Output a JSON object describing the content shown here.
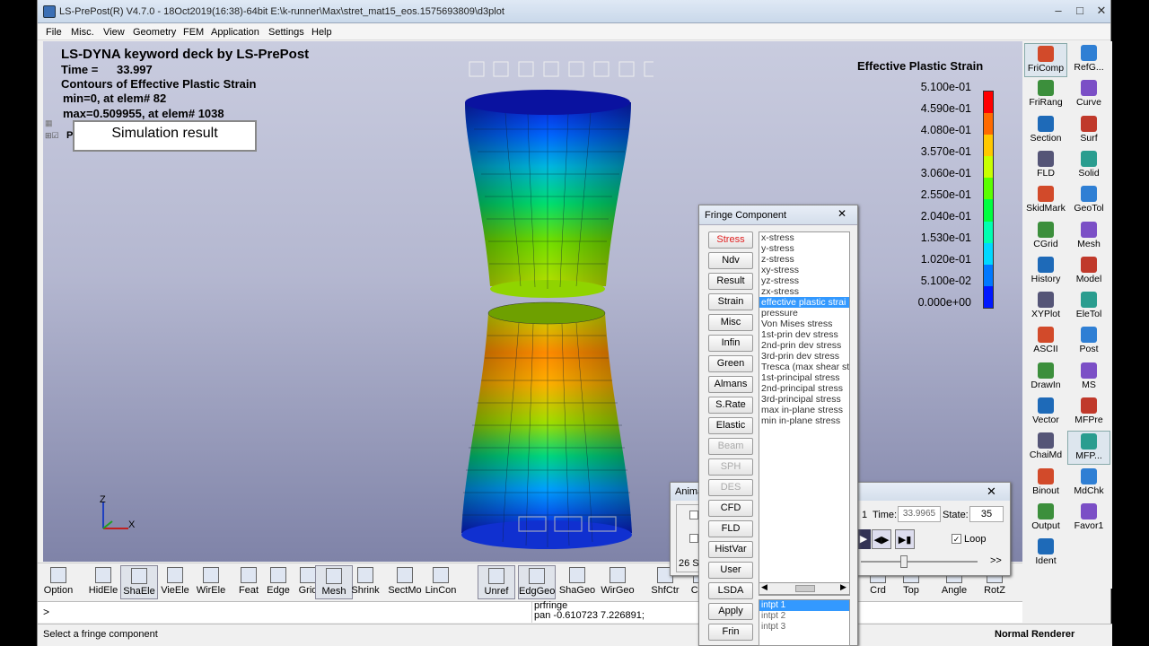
{
  "window": {
    "title": "LS-PrePost(R) V4.7.0 - 18Oct2019(16:38)-64bit E:\\k-runner\\Max\\stret_mat15_eos.1575693809\\d3plot"
  },
  "menu": [
    "File",
    "Misc.",
    "View",
    "Geometry",
    "FEM",
    "Application",
    "Settings",
    "Help"
  ],
  "viewport": {
    "header": "LS-DYNA keyword deck by LS-PrePost",
    "time_label": "Time =",
    "time_value": "33.997",
    "contour": "Contours of Effective Plastic Strain",
    "min": "min=0, at elem# 82",
    "max": "max=0.509955, at elem# 1038",
    "annotation": "Simulation result",
    "tree_label": "P",
    "axis_z": "Z",
    "axis_x": "X",
    "legend_title": "Effective Plastic Strain",
    "legend_labels": [
      "5.100e-01",
      "4.590e-01",
      "4.080e-01",
      "3.570e-01",
      "3.060e-01",
      "2.550e-01",
      "2.040e-01",
      "1.530e-01",
      "1.020e-01",
      "5.100e-02",
      "0.000e+00"
    ],
    "legend_colors": [
      "#ff0000",
      "#ff6a00",
      "#ffc800",
      "#c8ff00",
      "#5aff00",
      "#00ff40",
      "#00ffb0",
      "#00d8ff",
      "#0078ff",
      "#0018ff"
    ]
  },
  "right_panel": [
    [
      "FriComp",
      "RefG..."
    ],
    [
      "FriRang",
      "Curve"
    ],
    [
      "Section",
      "Surf"
    ],
    [
      "FLD",
      "Solid"
    ],
    [
      "SkidMark",
      "GeoTol"
    ],
    [
      "CGrid",
      "Mesh"
    ],
    [
      "History",
      "Model"
    ],
    [
      "XYPlot",
      "EleTol"
    ],
    [
      "ASCII",
      "Post"
    ],
    [
      "DrawIn",
      "MS"
    ],
    [
      "Vector",
      "MFPre"
    ],
    [
      "ChaiMd",
      "MFP..."
    ],
    [
      "Binout",
      "MdChk"
    ],
    [
      "Output",
      "Favor1"
    ],
    [
      "Ident",
      ""
    ]
  ],
  "bottom_toolbar": [
    "Option",
    "HidEle",
    "ShaEle",
    "VieEle",
    "WirEle",
    "Feat",
    "Edge",
    "Grid",
    "Mesh",
    "Shrink",
    "SectMo",
    "LinCon",
    "Unref",
    "EdgGeo",
    "ShaGeo",
    "WirGeo",
    "ShfCtr",
    "Clea",
    "Crd",
    "Top",
    "Angle",
    "RotZ"
  ],
  "cmd": {
    "prompt": ">",
    "log1": "prfringe",
    "log2": "pan -0.610723 7.226891;"
  },
  "status": {
    "left": "Select a fringe component",
    "right": "Normal Renderer"
  },
  "fringe_dialog": {
    "title": "Fringe Component",
    "buttons": [
      "Stress",
      "Ndv",
      "Result",
      "Strain",
      "Misc",
      "Infin",
      "Green",
      "Almans",
      "S.Rate",
      "Elastic",
      "Beam",
      "SPH",
      "DES",
      "CFD",
      "FLD",
      "HistVar",
      "User",
      "LSDA",
      "Apply",
      "Frin"
    ],
    "items": [
      "x-stress",
      "y-stress",
      "z-stress",
      "xy-stress",
      "yz-stress",
      "zx-stress",
      "effective plastic strai",
      "pressure",
      "Von Mises stress",
      "1st-prin dev stress",
      "2nd-prin dev stress",
      "3rd-prin dev stress",
      "Tresca (max shear st",
      "1st-principal stress",
      "2nd-principal stress",
      "3rd-principal stress",
      "max in-plane stress",
      "min in-plane stress"
    ],
    "selected": "effective plastic strai",
    "intpt": [
      "intpt 1",
      "intpt   2",
      "intpt   3"
    ]
  },
  "anim_dialog": {
    "title": "Anima",
    "frame": "1",
    "time_label": "Time:",
    "time_value": "33.9965",
    "state_label": "State:",
    "state_value": "35",
    "loop": "Loop",
    "left_text": "26  S",
    "speed": ">>"
  }
}
